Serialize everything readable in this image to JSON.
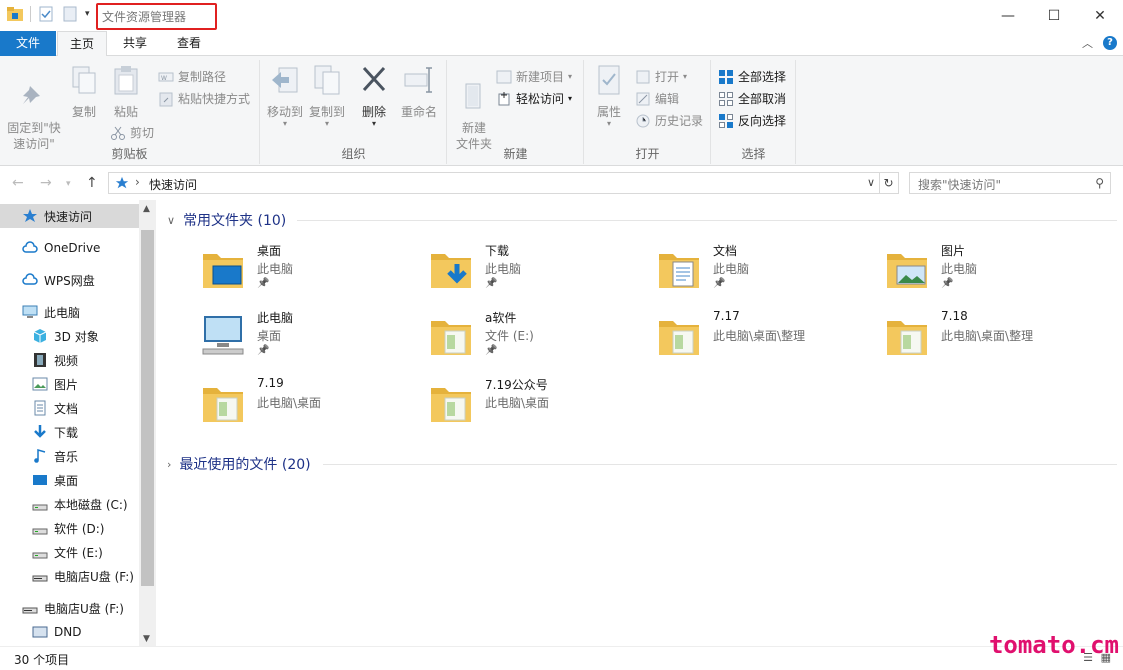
{
  "window": {
    "title": "文件资源管理器",
    "minimize": "—",
    "maximize": "☐",
    "close": "✕"
  },
  "tabs": {
    "file": "文件",
    "home": "主页",
    "share": "共享",
    "view": "查看"
  },
  "ribbon": {
    "clipboard": {
      "label": "剪贴板",
      "pin": "固定到\"快\n速访问\"",
      "copy": "复制",
      "paste": "粘贴",
      "copy_path": "复制路径",
      "paste_shortcut": "粘贴快捷方式",
      "cut": "剪切"
    },
    "organize": {
      "label": "组织",
      "move_to": "移动到",
      "copy_to": "复制到",
      "delete": "删除",
      "rename": "重命名"
    },
    "new": {
      "label": "新建",
      "new_folder": "新建\n文件夹",
      "new_item": "新建项目",
      "easy_access": "轻松访问"
    },
    "open": {
      "label": "打开",
      "properties": "属性",
      "open": "打开",
      "edit": "编辑",
      "history": "历史记录"
    },
    "select": {
      "label": "选择",
      "select_all": "全部选择",
      "select_none": "全部取消",
      "invert": "反向选择"
    }
  },
  "address": {
    "path": "快速访问",
    "search_placeholder": "搜索\"快速访问\""
  },
  "nav": {
    "items": [
      {
        "label": "快速访问",
        "icon": "star-icon"
      },
      {
        "label": "OneDrive",
        "icon": "cloud-icon"
      },
      {
        "label": "WPS网盘",
        "icon": "cloud-icon"
      },
      {
        "label": "此电脑",
        "icon": "computer-icon"
      },
      {
        "label": "3D 对象",
        "icon": "cube-icon"
      },
      {
        "label": "视频",
        "icon": "film-icon"
      },
      {
        "label": "图片",
        "icon": "picture-icon"
      },
      {
        "label": "文档",
        "icon": "document-icon"
      },
      {
        "label": "下载",
        "icon": "download-icon"
      },
      {
        "label": "音乐",
        "icon": "music-icon"
      },
      {
        "label": "桌面",
        "icon": "desktop-icon"
      },
      {
        "label": "本地磁盘 (C:)",
        "icon": "drive-icon"
      },
      {
        "label": "软件 (D:)",
        "icon": "drive-icon"
      },
      {
        "label": "文件 (E:)",
        "icon": "drive-icon"
      },
      {
        "label": "电脑店U盘 (F:)",
        "icon": "usb-drive-icon"
      },
      {
        "label": "电脑店U盘 (F:)",
        "icon": "usb-drive-icon"
      },
      {
        "label": "DND",
        "icon": "network-icon"
      }
    ]
  },
  "content": {
    "frequent_header": "常用文件夹 (10)",
    "recent_header": "最近使用的文件 (20)",
    "folders": [
      {
        "name": "桌面",
        "location": "此电脑",
        "pinned": true,
        "icon": "desktop-folder-icon"
      },
      {
        "name": "下载",
        "location": "此电脑",
        "pinned": true,
        "icon": "download-folder-icon"
      },
      {
        "name": "文档",
        "location": "此电脑",
        "pinned": true,
        "icon": "document-folder-icon"
      },
      {
        "name": "图片",
        "location": "此电脑",
        "pinned": true,
        "icon": "picture-folder-icon"
      },
      {
        "name": "此电脑",
        "location": "桌面",
        "pinned": true,
        "icon": "computer-icon"
      },
      {
        "name": "a软件",
        "location": "文件 (E:)",
        "pinned": true,
        "icon": "folder-icon"
      },
      {
        "name": "7.17",
        "location": "此电脑\\桌面\\整理",
        "pinned": false,
        "icon": "folder-icon"
      },
      {
        "name": "7.18",
        "location": "此电脑\\桌面\\整理",
        "pinned": false,
        "icon": "folder-icon"
      },
      {
        "name": "7.19",
        "location": "此电脑\\桌面",
        "pinned": false,
        "icon": "folder-icon"
      },
      {
        "name": "7.19公众号",
        "location": "此电脑\\桌面",
        "pinned": false,
        "icon": "folder-icon"
      }
    ]
  },
  "status": {
    "count": "30 个项目"
  },
  "watermark": "tomato.cm",
  "colors": {
    "accent": "#1979ca",
    "section_header": "#1e3287",
    "highlight_border": "#e02020",
    "watermark": "#e0106e",
    "folder": "#f3c85d"
  }
}
